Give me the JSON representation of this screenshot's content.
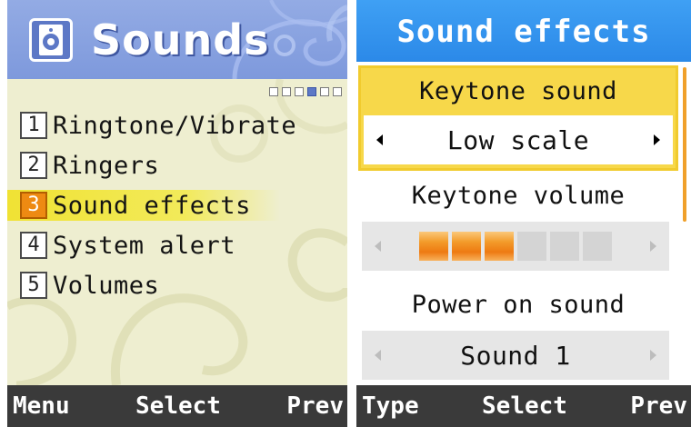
{
  "colors": {
    "left_header": "#8aa4e2",
    "left_background": "#eeeed0",
    "right_title_bar": "#3fa0f4",
    "focus_yellow": "#f7d84a",
    "selection_orange": "#ee8a12",
    "softkey_bar": "#3a3a3a"
  },
  "left_screen": {
    "header": {
      "icon": "speaker-icon",
      "title": "Sounds"
    },
    "page_indicator": {
      "total": 6,
      "active": 4
    },
    "menu": [
      {
        "number": "1",
        "label": "Ringtone/Vibrate",
        "selected": false
      },
      {
        "number": "2",
        "label": "Ringers",
        "selected": false
      },
      {
        "number": "3",
        "label": "Sound effects",
        "selected": true
      },
      {
        "number": "4",
        "label": "System alert",
        "selected": false
      },
      {
        "number": "5",
        "label": "Volumes",
        "selected": false
      }
    ],
    "softkeys": {
      "left": "Menu",
      "center": "Select",
      "right": "Prev"
    }
  },
  "right_screen": {
    "title": "Sound effects",
    "settings": [
      {
        "label": "Keytone sound",
        "value": "Low scale",
        "focused": true
      },
      {
        "label": "Keytone volume",
        "level": 3,
        "max": 6
      },
      {
        "label": "Power on sound",
        "value": "Sound 1",
        "focused": false
      }
    ],
    "softkeys": {
      "left": "Type",
      "center": "Select",
      "right": "Prev"
    }
  }
}
